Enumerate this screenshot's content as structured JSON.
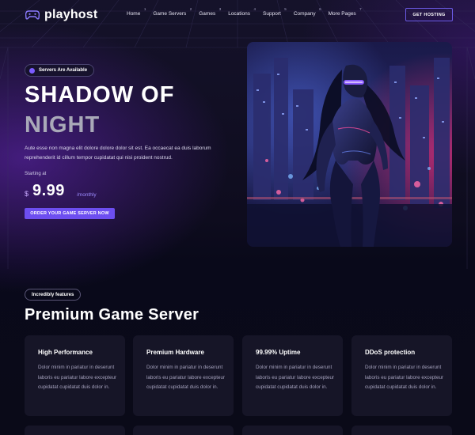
{
  "brand": {
    "name": "playhost",
    "logo_icon": "gamepad-icon",
    "accent": "#6d4ef0"
  },
  "nav": {
    "items": [
      {
        "label": "Home",
        "num": "1"
      },
      {
        "label": "Game Servers",
        "num": "2"
      },
      {
        "label": "Games",
        "num": "3"
      },
      {
        "label": "Locations",
        "num": "4"
      },
      {
        "label": "Support",
        "num": "5"
      },
      {
        "label": "Company",
        "num": "6"
      },
      {
        "label": "More Pages",
        "num": "7"
      }
    ],
    "cta_label": "GET HOSTING"
  },
  "hero": {
    "badge": "Servers Are Available",
    "title_line1": "SHADOW OF",
    "title_line2": "NIGHT",
    "description": "Aute esse non magna elit dolore dolore dolor sit est. Ea occaecat ea duis laborum reprehenderit id cillum tempor cupidatat qui nisi proident nostrud.",
    "starting_label": "Starting at",
    "currency": "$",
    "price": "9.99",
    "period": "/monthly",
    "order_button": "ORDER YOUR GAME SERVER NOW"
  },
  "features": {
    "badge": "Incredibly features",
    "title": "Premium Game Server",
    "cards": [
      {
        "title": "High Performance",
        "description": "Dolor minim in pariatur in deserunt laboris eu pariatur labore excepteur cupidatat cupidatat duis dolor in."
      },
      {
        "title": "Premium Hardware",
        "description": "Dolor minim in pariatur in deserunt laboris eu pariatur labore excepteur cupidatat cupidatat duis dolor in."
      },
      {
        "title": "99.99% Uptime",
        "description": "Dolor minim in pariatur in deserunt laboris eu pariatur labore excepteur cupidatat cupidatat duis dolor in."
      },
      {
        "title": "DDoS protection",
        "description": "Dolor minim in pariatur in deserunt laboris eu pariatur labore excepteur cupidatat cupidatat duis dolor in."
      }
    ]
  }
}
